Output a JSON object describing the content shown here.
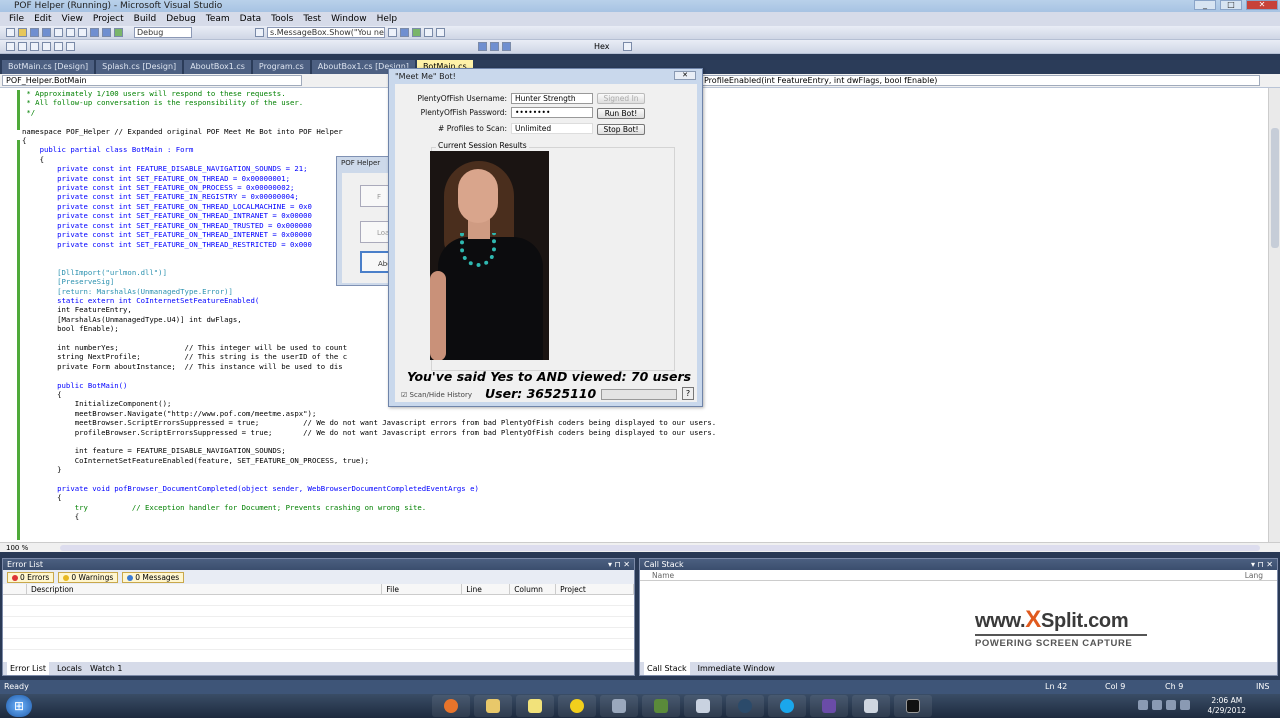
{
  "window": {
    "title": "POF Helper (Running) - Microsoft Visual Studio"
  },
  "menu": [
    "File",
    "Edit",
    "View",
    "Project",
    "Build",
    "Debug",
    "Team",
    "Data",
    "Tools",
    "Test",
    "Window",
    "Help"
  ],
  "toolbar": {
    "config_combo": "Debug",
    "find_combo": "s.MessageBox.Show(\"You need",
    "hex_label": "Hex"
  },
  "tabs": [
    "BotMain.cs [Design]",
    "Splash.cs [Design]",
    "AboutBox1.cs",
    "Program.cs",
    "AboutBox1.cs [Design]",
    "BotMain.cs"
  ],
  "nav": {
    "left": "POF_Helper.BotMain",
    "right": "ProfileEnabled(int FeatureEntry, int dwFlags, bool fEnable)"
  },
  "code": {
    "l1": " * Approximately 1/100 users will respond to these requests.",
    "l2": " * All follow-up conversation is the responsibility of the user.",
    "l3": " */",
    "l4": "namespace POF_Helper // Expanded original POF Meet Me Bot into POF Helper",
    "l5": "{",
    "l6": "    public partial class BotMain : Form",
    "l7": "    {",
    "l8": "        private const int FEATURE_DISABLE_NAVIGATION_SOUNDS = 21;",
    "l9": "        private const int SET_FEATURE_ON_THREAD = 0x00000001;",
    "l10": "        private const int SET_FEATURE_ON_PROCESS = 0x00000002;",
    "l11": "        private const int SET_FEATURE_IN_REGISTRY = 0x00000004;",
    "l12": "        private const int SET_FEATURE_ON_THREAD_LOCALMACHINE = 0x0",
    "l13": "        private const int SET_FEATURE_ON_THREAD_INTRANET = 0x00000",
    "l14": "        private const int SET_FEATURE_ON_THREAD_TRUSTED = 0x000000",
    "l15": "        private const int SET_FEATURE_ON_THREAD_INTERNET = 0x00000",
    "l16": "        private const int SET_FEATURE_ON_THREAD_RESTRICTED = 0x000",
    "l17": "        [DllImport(\"urlmon.dll\")]",
    "l18": "        [PreserveSig]",
    "l19": "        [return: MarshalAs(UnmanagedType.Error)]",
    "l20": "        static extern int CoInternetSetFeatureEnabled(",
    "l21": "        int FeatureEntry,",
    "l22": "        [MarshalAs(UnmanagedType.U4)] int dwFlags,",
    "l23": "        bool fEnable);",
    "l24": "        int numberYes;               // This integer will be used to count",
    "l25": "        string NextProfile;          // This string is the userID of the c",
    "l26": "        private Form aboutInstance;  // This instance will be used to dis",
    "l27": "        public BotMain()",
    "l28": "        {",
    "l29": "            InitializeComponent();",
    "l30": "            meetBrowser.Navigate(\"http://www.pof.com/meetme.aspx\");",
    "l31": "            meetBrowser.ScriptErrorsSuppressed = true;          // We do not want Javascript errors from bad PlentyOfFish coders being displayed to our users.",
    "l32": "            profileBrowser.ScriptErrorsSuppressed = true;       // We do not want Javascript errors from bad PlentyOfFish coders being displayed to our users.",
    "l33": "            int feature = FEATURE_DISABLE_NAVIGATION_SOUNDS;",
    "l34": "            CoInternetSetFeatureEnabled(feature, SET_FEATURE_ON_PROCESS, true);",
    "l35": "        }",
    "l36": "        private void pofBrowser_DocumentCompleted(object sender, WebBrowserDocumentCompletedEventArgs e)",
    "l37": "        {",
    "l38": "            try          // Exception handler for Document; Prevents crashing on wrong site.",
    "l39": "            {"
  },
  "editor": {
    "zoom": "100 %"
  },
  "error_list": {
    "title": "Error List",
    "errors": "0 Errors",
    "warnings": "0 Warnings",
    "messages": "0 Messages",
    "columns": [
      "Description",
      "File",
      "Line",
      "Column",
      "Project"
    ],
    "tabs": [
      "Error List",
      "Locals",
      "Watch 1"
    ]
  },
  "call_stack": {
    "title": "Call Stack",
    "col_name": "Name",
    "col_lang": "Lang",
    "tabs": [
      "Call Stack",
      "Immediate Window"
    ]
  },
  "watermark": {
    "line1_pre": "www.",
    "line1_x": "X",
    "line1_post": "Split.com",
    "line2": "POWERING SCREEN CAPTURE"
  },
  "status": {
    "left": "Ready",
    "ln": "Ln 42",
    "col": "Col 9",
    "ch": "Ch 9",
    "ins": "INS"
  },
  "clock": {
    "time": "2:06 AM",
    "date": "4/29/2012"
  },
  "dialog2": {
    "title": "POF Helper",
    "btn1": "F",
    "btn2": "Load",
    "btn3": "Abou"
  },
  "bot_dialog": {
    "title": "\"Meet Me\" Bot!",
    "username_label": "PlentyOfFish Username:",
    "username_value": "Hunter Strength",
    "password_label": "PlentyOfFish Password:",
    "password_value": "••••••••",
    "profiles_label": "# Profiles to Scan:",
    "profiles_value": "Unlimited",
    "signed_in": "Signed In",
    "run_bot": "Run Bot!",
    "stop_bot": "Stop Bot!",
    "group_label": "Current Session Results",
    "stats_line1": "You've said Yes to AND viewed: 70 users",
    "stats_line2": "User: 36525110",
    "scan_history": "Scan/Hide History",
    "help": "?"
  }
}
